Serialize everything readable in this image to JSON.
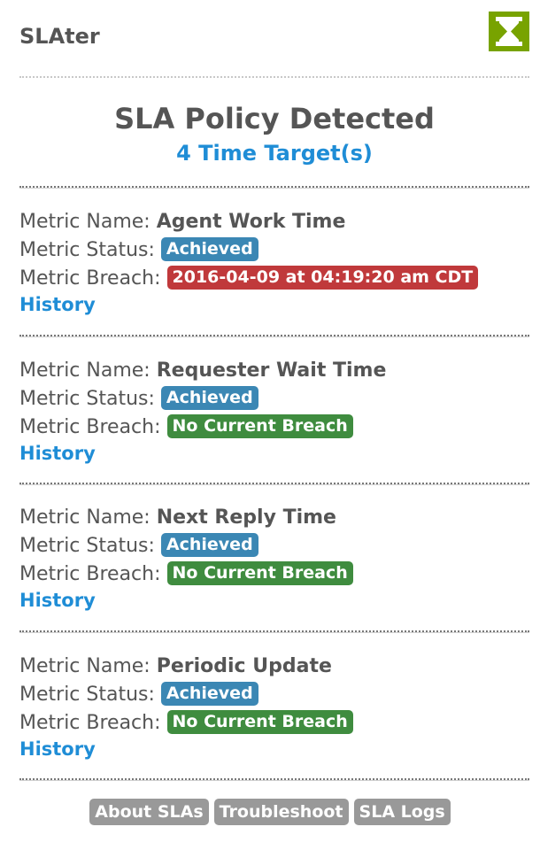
{
  "app": {
    "title": "SLAter",
    "logo_icon": "hourglass-icon",
    "logo_color": "#78a300"
  },
  "policy": {
    "title": "SLA Policy Detected",
    "count_text": "4 Time Target(s)"
  },
  "labels": {
    "metric_name": "Metric Name:",
    "metric_status": "Metric Status:",
    "metric_breach": "Metric Breach:",
    "history": "History"
  },
  "metrics": [
    {
      "name": "Agent Work Time",
      "status": "Achieved",
      "status_color": "#3b87b4",
      "breach": "2016-04-09 at 04:19:20 am CDT",
      "breach_color": "#c0393b"
    },
    {
      "name": "Requester Wait Time",
      "status": "Achieved",
      "status_color": "#3b87b4",
      "breach": "No Current Breach",
      "breach_color": "#3f8c3f"
    },
    {
      "name": "Next Reply Time",
      "status": "Achieved",
      "status_color": "#3b87b4",
      "breach": "No Current Breach",
      "breach_color": "#3f8c3f"
    },
    {
      "name": "Periodic Update",
      "status": "Achieved",
      "status_color": "#3b87b4",
      "breach": "No Current Breach",
      "breach_color": "#3f8c3f"
    }
  ],
  "footer": {
    "about": "About SLAs",
    "troubleshoot": "Troubleshoot",
    "logs": "SLA Logs"
  }
}
